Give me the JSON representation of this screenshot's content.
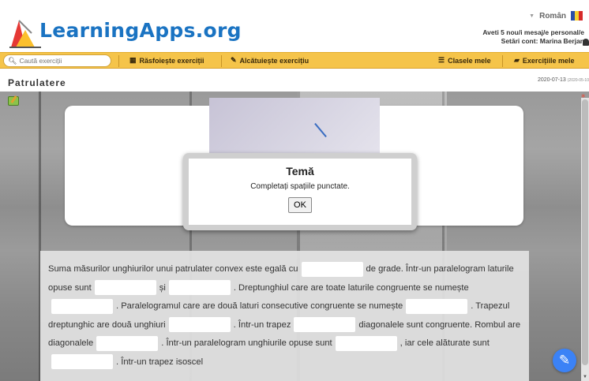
{
  "header": {
    "logo_text": "LearningApps.org",
    "language": "Român",
    "messages": "Aveti 5 nou/i mesaj/e personal/e",
    "account": "Setări cont: Marina Berjan"
  },
  "nav": {
    "search_placeholder": "Caută exerciții",
    "browse": "Răsfoiește exerciții",
    "create": "Alcătuiește exercițiu",
    "classes": "Clasele mele",
    "my_exercises": "Exercițiile mele"
  },
  "page": {
    "title": "Patrulatere",
    "date": "2020-07-13",
    "date_small": "(2020-05-10"
  },
  "dialog": {
    "title": "Temă",
    "message": "Completați spațiile punctate.",
    "ok_label": "OK"
  },
  "exercise": {
    "s1": "Suma măsurilor unghiurilor unui patrulater convex este egală cu",
    "s2": "de grade. Într-un paralelogram laturile opuse sunt",
    "s3": "și",
    "s4": ". Dreptunghiul care are toate laturile congruente se numește",
    "s5": ". Paralelogramul care are două laturi consecutive congruente se numește",
    "s6": ". Trapezul dreptunghic are două unghiuri",
    "s7": ". Într-un trapez",
    "s8": "diagonalele sunt congruente. Rombul are diagonalele",
    "s9": ". Într-un paralelogram unghiurile opuse sunt",
    "s10": ", iar cele alăturate sunt",
    "s11": ". Într-un trapez isoscel"
  },
  "icons": {
    "help": "help-icon",
    "search": "search-icon"
  },
  "colors": {
    "nav_bg": "#f5c44a",
    "logo": "#1a73c2",
    "help_button": "#3b82f6"
  }
}
